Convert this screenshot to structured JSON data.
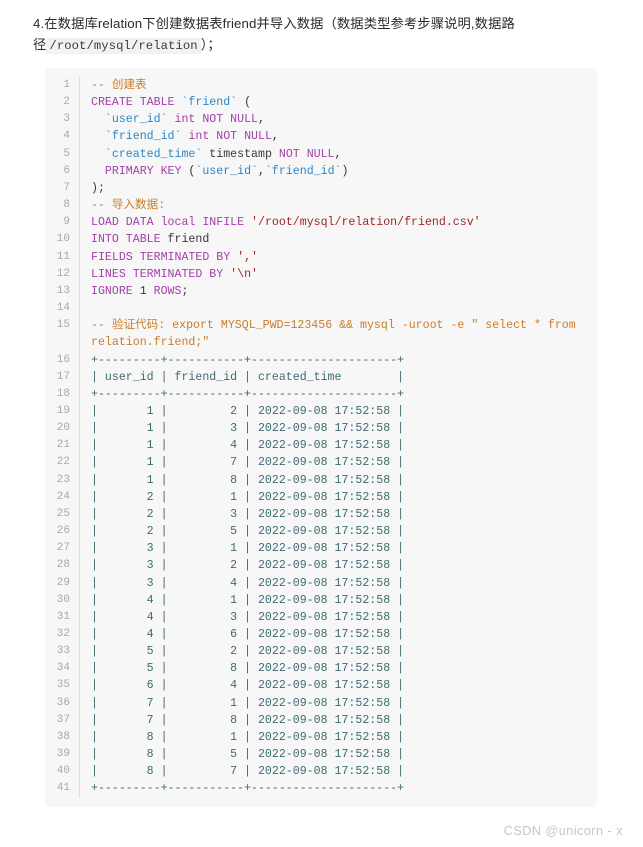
{
  "intro": {
    "prefix": "4.在数据库relation下创建数据表friend并导入数据（数据类型参考步骤说明,数据路径",
    "inline_code": "/root/mysql/relation",
    "suffix": "）；"
  },
  "code_block": {
    "language": "sql",
    "colors": {
      "background": "#f7f7f7",
      "gutter_text": "#a8a8a8",
      "comment": "#c97d2c",
      "keyword": "#a43fa8",
      "identifier": "#2d86c4",
      "string": "#a3252a",
      "output": "#3f6b72",
      "plain": "#383838"
    },
    "lines": [
      {
        "n": 1,
        "tokens": [
          {
            "t": "comment",
            "s": "-- 创建表"
          }
        ]
      },
      {
        "n": 2,
        "tokens": [
          {
            "t": "keyword",
            "s": "CREATE TABLE "
          },
          {
            "t": "ident",
            "s": "`friend`"
          },
          {
            "t": "plain",
            "s": " ("
          }
        ]
      },
      {
        "n": 3,
        "tokens": [
          {
            "t": "plain",
            "s": "  "
          },
          {
            "t": "ident",
            "s": "`user_id`"
          },
          {
            "t": "plain",
            "s": " "
          },
          {
            "t": "keyword",
            "s": "int NOT NULL"
          },
          {
            "t": "plain",
            "s": ","
          }
        ]
      },
      {
        "n": 4,
        "tokens": [
          {
            "t": "plain",
            "s": "  "
          },
          {
            "t": "ident",
            "s": "`friend_id`"
          },
          {
            "t": "plain",
            "s": " "
          },
          {
            "t": "keyword",
            "s": "int NOT NULL"
          },
          {
            "t": "plain",
            "s": ","
          }
        ]
      },
      {
        "n": 5,
        "tokens": [
          {
            "t": "plain",
            "s": "  "
          },
          {
            "t": "ident",
            "s": "`created_time`"
          },
          {
            "t": "plain",
            "s": " timestamp "
          },
          {
            "t": "keyword",
            "s": "NOT NULL"
          },
          {
            "t": "plain",
            "s": ","
          }
        ]
      },
      {
        "n": 6,
        "tokens": [
          {
            "t": "plain",
            "s": "  "
          },
          {
            "t": "keyword",
            "s": "PRIMARY KEY"
          },
          {
            "t": "plain",
            "s": " ("
          },
          {
            "t": "ident",
            "s": "`user_id`"
          },
          {
            "t": "plain",
            "s": ","
          },
          {
            "t": "ident",
            "s": "`friend_id`"
          },
          {
            "t": "plain",
            "s": ")"
          }
        ]
      },
      {
        "n": 7,
        "tokens": [
          {
            "t": "plain",
            "s": ");"
          }
        ]
      },
      {
        "n": 8,
        "tokens": [
          {
            "t": "comment",
            "s": "-- 导入数据:"
          }
        ]
      },
      {
        "n": 9,
        "tokens": [
          {
            "t": "keyword",
            "s": "LOAD DATA local INFILE "
          },
          {
            "t": "string",
            "s": "'/root/mysql/relation/friend.csv'"
          }
        ]
      },
      {
        "n": 10,
        "tokens": [
          {
            "t": "keyword",
            "s": "INTO TABLE "
          },
          {
            "t": "plain",
            "s": "friend"
          }
        ]
      },
      {
        "n": 11,
        "tokens": [
          {
            "t": "keyword",
            "s": "FIELDS TERMINATED BY "
          },
          {
            "t": "string",
            "s": "','"
          }
        ]
      },
      {
        "n": 12,
        "tokens": [
          {
            "t": "keyword",
            "s": "LINES TERMINATED BY "
          },
          {
            "t": "string",
            "s": "'\\n'"
          }
        ]
      },
      {
        "n": 13,
        "tokens": [
          {
            "t": "keyword",
            "s": "IGNORE "
          },
          {
            "t": "plain",
            "s": "1 "
          },
          {
            "t": "keyword",
            "s": "ROWS"
          },
          {
            "t": "plain",
            "s": ";"
          }
        ]
      },
      {
        "n": 14,
        "tokens": [
          {
            "t": "plain",
            "s": ""
          }
        ]
      },
      {
        "n": 15,
        "tokens": [
          {
            "t": "comment",
            "s": "-- 验证代码: export MYSQL_PWD=123456 && mysql -uroot -e \" select * from relation.friend;\""
          }
        ]
      },
      {
        "n": 16,
        "tokens": [
          {
            "t": "out",
            "s": "+---------+-----------+---------------------+"
          }
        ]
      },
      {
        "n": 17,
        "tokens": [
          {
            "t": "out",
            "s": "| user_id | friend_id | created_time        |"
          }
        ]
      },
      {
        "n": 18,
        "tokens": [
          {
            "t": "out",
            "s": "+---------+-----------+---------------------+"
          }
        ]
      },
      {
        "n": 19,
        "tokens": [
          {
            "t": "out",
            "s": "|       1 |         2 | 2022-09-08 17:52:58 |"
          }
        ]
      },
      {
        "n": 20,
        "tokens": [
          {
            "t": "out",
            "s": "|       1 |         3 | 2022-09-08 17:52:58 |"
          }
        ]
      },
      {
        "n": 21,
        "tokens": [
          {
            "t": "out",
            "s": "|       1 |         4 | 2022-09-08 17:52:58 |"
          }
        ]
      },
      {
        "n": 22,
        "tokens": [
          {
            "t": "out",
            "s": "|       1 |         7 | 2022-09-08 17:52:58 |"
          }
        ]
      },
      {
        "n": 23,
        "tokens": [
          {
            "t": "out",
            "s": "|       1 |         8 | 2022-09-08 17:52:58 |"
          }
        ]
      },
      {
        "n": 24,
        "tokens": [
          {
            "t": "out",
            "s": "|       2 |         1 | 2022-09-08 17:52:58 |"
          }
        ]
      },
      {
        "n": 25,
        "tokens": [
          {
            "t": "out",
            "s": "|       2 |         3 | 2022-09-08 17:52:58 |"
          }
        ]
      },
      {
        "n": 26,
        "tokens": [
          {
            "t": "out",
            "s": "|       2 |         5 | 2022-09-08 17:52:58 |"
          }
        ]
      },
      {
        "n": 27,
        "tokens": [
          {
            "t": "out",
            "s": "|       3 |         1 | 2022-09-08 17:52:58 |"
          }
        ]
      },
      {
        "n": 28,
        "tokens": [
          {
            "t": "out",
            "s": "|       3 |         2 | 2022-09-08 17:52:58 |"
          }
        ]
      },
      {
        "n": 29,
        "tokens": [
          {
            "t": "out",
            "s": "|       3 |         4 | 2022-09-08 17:52:58 |"
          }
        ]
      },
      {
        "n": 30,
        "tokens": [
          {
            "t": "out",
            "s": "|       4 |         1 | 2022-09-08 17:52:58 |"
          }
        ]
      },
      {
        "n": 31,
        "tokens": [
          {
            "t": "out",
            "s": "|       4 |         3 | 2022-09-08 17:52:58 |"
          }
        ]
      },
      {
        "n": 32,
        "tokens": [
          {
            "t": "out",
            "s": "|       4 |         6 | 2022-09-08 17:52:58 |"
          }
        ]
      },
      {
        "n": 33,
        "tokens": [
          {
            "t": "out",
            "s": "|       5 |         2 | 2022-09-08 17:52:58 |"
          }
        ]
      },
      {
        "n": 34,
        "tokens": [
          {
            "t": "out",
            "s": "|       5 |         8 | 2022-09-08 17:52:58 |"
          }
        ]
      },
      {
        "n": 35,
        "tokens": [
          {
            "t": "out",
            "s": "|       6 |         4 | 2022-09-08 17:52:58 |"
          }
        ]
      },
      {
        "n": 36,
        "tokens": [
          {
            "t": "out",
            "s": "|       7 |         1 | 2022-09-08 17:52:58 |"
          }
        ]
      },
      {
        "n": 37,
        "tokens": [
          {
            "t": "out",
            "s": "|       7 |         8 | 2022-09-08 17:52:58 |"
          }
        ]
      },
      {
        "n": 38,
        "tokens": [
          {
            "t": "out",
            "s": "|       8 |         1 | 2022-09-08 17:52:58 |"
          }
        ]
      },
      {
        "n": 39,
        "tokens": [
          {
            "t": "out",
            "s": "|       8 |         5 | 2022-09-08 17:52:58 |"
          }
        ]
      },
      {
        "n": 40,
        "tokens": [
          {
            "t": "out",
            "s": "|       8 |         7 | 2022-09-08 17:52:58 |"
          }
        ]
      },
      {
        "n": 41,
        "tokens": [
          {
            "t": "out",
            "s": "+---------+-----------+---------------------+"
          }
        ]
      }
    ],
    "result_table": {
      "headers": [
        "user_id",
        "friend_id",
        "created_time"
      ],
      "rows": [
        [
          1,
          2,
          "2022-09-08 17:52:58"
        ],
        [
          1,
          3,
          "2022-09-08 17:52:58"
        ],
        [
          1,
          4,
          "2022-09-08 17:52:58"
        ],
        [
          1,
          7,
          "2022-09-08 17:52:58"
        ],
        [
          1,
          8,
          "2022-09-08 17:52:58"
        ],
        [
          2,
          1,
          "2022-09-08 17:52:58"
        ],
        [
          2,
          3,
          "2022-09-08 17:52:58"
        ],
        [
          2,
          5,
          "2022-09-08 17:52:58"
        ],
        [
          3,
          1,
          "2022-09-08 17:52:58"
        ],
        [
          3,
          2,
          "2022-09-08 17:52:58"
        ],
        [
          3,
          4,
          "2022-09-08 17:52:58"
        ],
        [
          4,
          1,
          "2022-09-08 17:52:58"
        ],
        [
          4,
          3,
          "2022-09-08 17:52:58"
        ],
        [
          4,
          6,
          "2022-09-08 17:52:58"
        ],
        [
          5,
          2,
          "2022-09-08 17:52:58"
        ],
        [
          5,
          8,
          "2022-09-08 17:52:58"
        ],
        [
          6,
          4,
          "2022-09-08 17:52:58"
        ],
        [
          7,
          1,
          "2022-09-08 17:52:58"
        ],
        [
          7,
          8,
          "2022-09-08 17:52:58"
        ],
        [
          8,
          1,
          "2022-09-08 17:52:58"
        ],
        [
          8,
          5,
          "2022-09-08 17:52:58"
        ],
        [
          8,
          7,
          "2022-09-08 17:52:58"
        ]
      ]
    }
  },
  "watermark": "CSDN @unicorn - x"
}
